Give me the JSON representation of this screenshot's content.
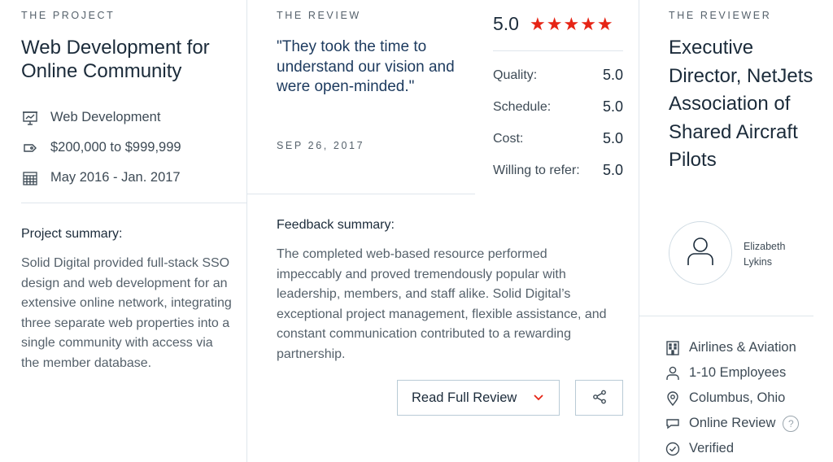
{
  "project": {
    "eyebrow": "THE PROJECT",
    "title": "Web Development for Online Community",
    "meta": [
      {
        "icon": "presentation-icon",
        "text": "Web Development"
      },
      {
        "icon": "price-tag-icon",
        "text": "$200,000 to $999,999"
      },
      {
        "icon": "calendar-icon",
        "text": "May 2016 - Jan. 2017"
      }
    ],
    "summary_heading": "Project summary:",
    "summary": "Solid Digital provided full-stack SSO design and web development for an extensive online network, integrating three separate web properties into a single community with access via the member database."
  },
  "review": {
    "eyebrow": "THE REVIEW",
    "quote": "\"They took the time to understand our vision and were open-minded.\"",
    "date": "SEP 26, 2017",
    "overall_score": "5.0",
    "stars": 5,
    "star_color": "#e62415",
    "ratings": [
      {
        "label": "Quality:",
        "value": "5.0"
      },
      {
        "label": "Schedule:",
        "value": "5.0"
      },
      {
        "label": "Cost:",
        "value": "5.0"
      },
      {
        "label": "Willing to refer:",
        "value": "5.0"
      }
    ],
    "feedback_heading": "Feedback summary:",
    "feedback": "The completed web-based resource performed impeccably and proved tremendously popular with leadership, members, and staff alike. Solid Digital’s exceptional project management, flexible assistance, and constant communication contributed to a rewarding partnership.",
    "read_full_label": "Read Full Review",
    "share_icon": "share-icon"
  },
  "reviewer": {
    "eyebrow": "THE REVIEWER",
    "title": "Executive Director, NetJets Association of Shared Aircraft Pilots",
    "name": "Elizabeth Lykins",
    "details": [
      {
        "icon": "building-icon",
        "text": "Airlines & Aviation"
      },
      {
        "icon": "person-icon",
        "text": "1-10 Employees"
      },
      {
        "icon": "location-pin-icon",
        "text": "Columbus, Ohio"
      },
      {
        "icon": "speech-bubble-icon",
        "text": "Online Review"
      },
      {
        "icon": "check-circle-icon",
        "text": "Verified"
      }
    ],
    "help_glyph": "?"
  }
}
